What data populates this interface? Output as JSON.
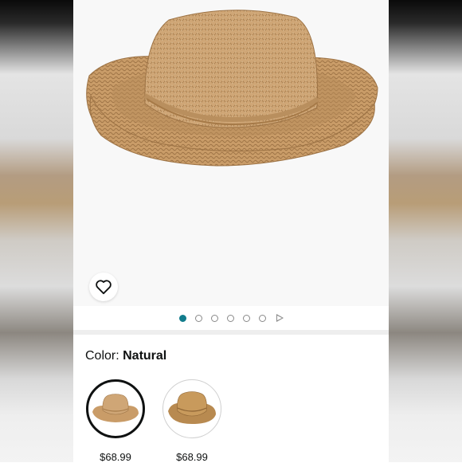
{
  "product": {
    "image_dots_count": 6,
    "active_dot_index": 0
  },
  "color": {
    "label": "Color: ",
    "value": "Natural"
  },
  "variants": [
    {
      "price": "$68.99",
      "selected": true
    },
    {
      "price": "$68.99",
      "selected": false
    }
  ],
  "icons": {
    "wishlist": "heart-icon",
    "carousel_next": "play-icon"
  },
  "colors": {
    "accent_dot": "#127c8c",
    "straw": "#c9a06e"
  }
}
